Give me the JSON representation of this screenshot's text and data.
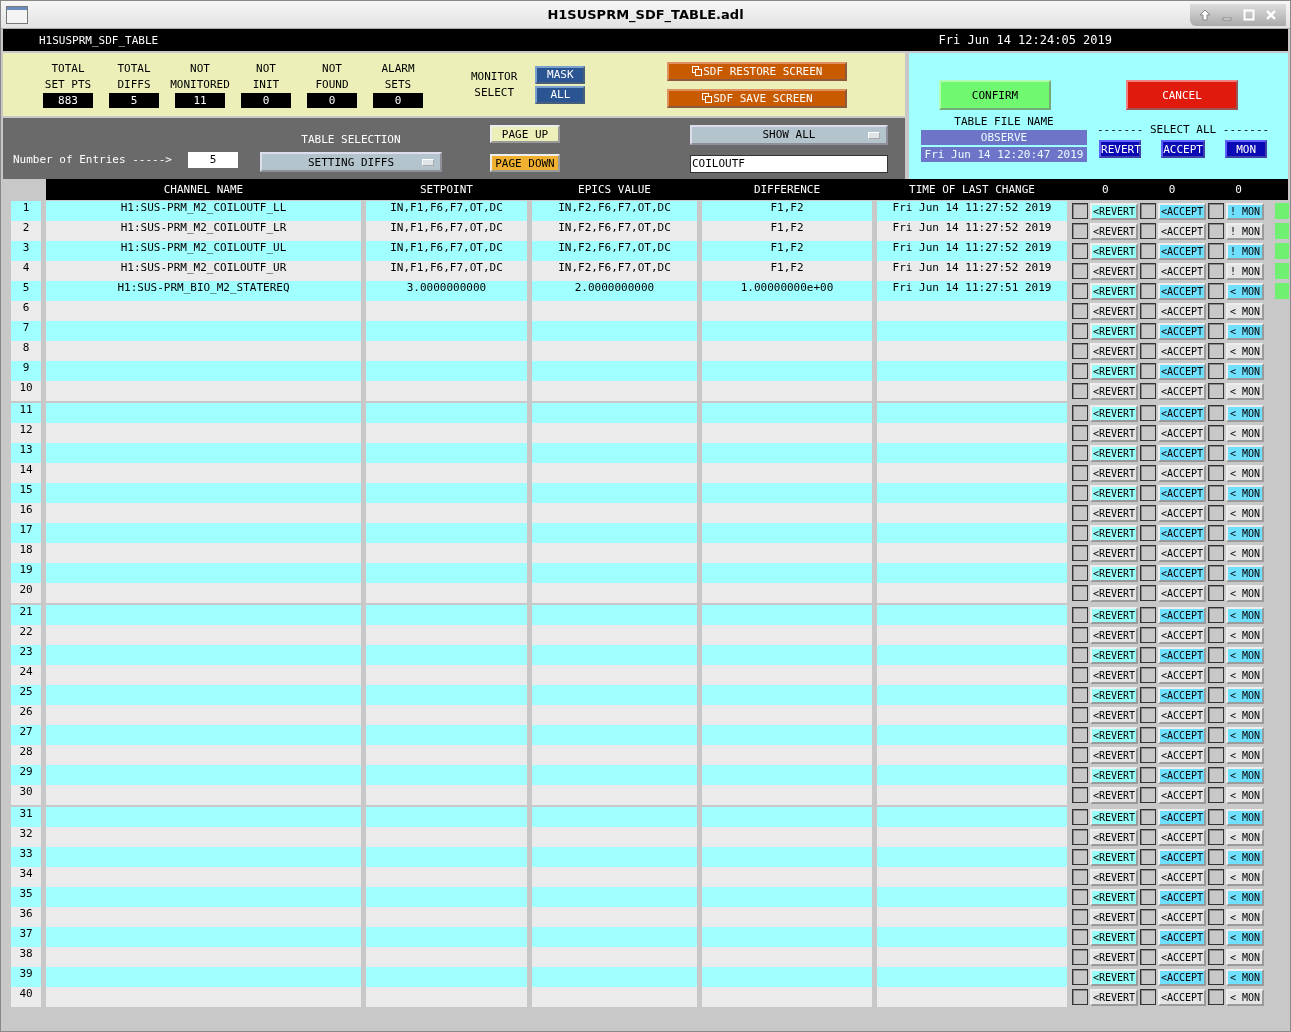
{
  "window": {
    "title": "H1SUSPRM_SDF_TABLE.adl"
  },
  "header_bar": {
    "screen_name": "H1SUSPRM_SDF_TABLE",
    "clock": "Fri Jun 14 12:24:05 2019"
  },
  "stats": [
    {
      "lines": [
        "TOTAL",
        "SET PTS"
      ],
      "value": "883"
    },
    {
      "lines": [
        "TOTAL",
        "DIFFS"
      ],
      "value": "5"
    },
    {
      "lines": [
        "NOT",
        "MONITORED"
      ],
      "value": "11"
    },
    {
      "lines": [
        "NOT",
        "INIT"
      ],
      "value": "0"
    },
    {
      "lines": [
        "NOT",
        "FOUND"
      ],
      "value": "0"
    },
    {
      "lines": [
        "ALARM",
        "SETS"
      ],
      "value": "0"
    }
  ],
  "monitor_select": {
    "lines": [
      "MONITOR",
      "SELECT"
    ],
    "buttons": [
      "MASK",
      "ALL"
    ]
  },
  "screen_buttons": [
    "SDF RESTORE SCREEN",
    "SDF SAVE SCREEN"
  ],
  "confirm": "CONFIRM",
  "cancel": "CANCEL",
  "table_file": {
    "label": "TABLE FILE NAME",
    "name": "OBSERVE",
    "date": "Fri Jun 14 12:20:47 2019"
  },
  "select_all": {
    "label": "------- SELECT ALL -------",
    "buttons": [
      "REVERT",
      "ACCEPT",
      "MON"
    ]
  },
  "entries": {
    "label": "Number of Entries ----->",
    "value": "5"
  },
  "table_selection": {
    "label": "TABLE SELECTION",
    "value": "SETTING DIFFS"
  },
  "page_buttons": [
    "PAGE UP",
    "PAGE DOWN"
  ],
  "filter": {
    "value": "SHOW ALL"
  },
  "search": {
    "value": "COILOUTF"
  },
  "columns": [
    "CHANNEL NAME",
    "SETPOINT",
    "EPICS VALUE",
    "DIFFERENCE",
    "TIME OF LAST CHANGE",
    "0",
    "0",
    "0"
  ],
  "rows": [
    {
      "number": "1",
      "channel": "H1:SUS-PRM_M2_COILOUTF_LL",
      "setpoint": "IN,F1,F6,F7,OT,DC",
      "epics_value": "IN,F2,F6,F7,OT,DC",
      "difference": "F1,F2",
      "time": "Fri Jun 14 11:27:52 2019",
      "revert_label": "<REVERT",
      "accept_label": "<ACCEPT",
      "mon_label": "! MON",
      "flagged": true,
      "revert_checked": false,
      "accept_checked": false,
      "mon_checked": false
    },
    {
      "number": "2",
      "channel": "H1:SUS-PRM_M2_COILOUTF_LR",
      "setpoint": "IN,F1,F6,F7,OT,DC",
      "epics_value": "IN,F2,F6,F7,OT,DC",
      "difference": "F1,F2",
      "time": "Fri Jun 14 11:27:52 2019",
      "revert_label": "<REVERT",
      "accept_label": "<ACCEPT",
      "mon_label": "! MON",
      "flagged": true,
      "revert_checked": false,
      "accept_checked": false,
      "mon_checked": false
    },
    {
      "number": "3",
      "channel": "H1:SUS-PRM_M2_COILOUTF_UL",
      "setpoint": "IN,F1,F6,F7,OT,DC",
      "epics_value": "IN,F2,F6,F7,OT,DC",
      "difference": "F1,F2",
      "time": "Fri Jun 14 11:27:52 2019",
      "revert_label": "<REVERT",
      "accept_label": "<ACCEPT",
      "mon_label": "! MON",
      "flagged": true,
      "revert_checked": false,
      "accept_checked": false,
      "mon_checked": false
    },
    {
      "number": "4",
      "channel": "H1:SUS-PRM_M2_COILOUTF_UR",
      "setpoint": "IN,F1,F6,F7,OT,DC",
      "epics_value": "IN,F2,F6,F7,OT,DC",
      "difference": "F1,F2",
      "time": "Fri Jun 14 11:27:52 2019",
      "revert_label": "<REVERT",
      "accept_label": "<ACCEPT",
      "mon_label": "! MON",
      "flagged": true,
      "revert_checked": false,
      "accept_checked": false,
      "mon_checked": false
    },
    {
      "number": "5",
      "channel": "H1:SUS-PRM_BIO_M2_STATEREQ",
      "setpoint": "3.0000000000",
      "epics_value": "2.0000000000",
      "difference": "1.00000000e+00",
      "time": "Fri Jun 14 11:27:51 2019",
      "revert_label": "<REVERT",
      "accept_label": "<ACCEPT",
      "mon_label": "< MON",
      "flagged": true,
      "revert_checked": false,
      "accept_checked": false,
      "mon_checked": false
    },
    {
      "number": "6",
      "revert_label": "<REVERT",
      "accept_label": "<ACCEPT",
      "mon_label": "< MON",
      "flagged": false,
      "revert_checked": false,
      "accept_checked": false,
      "mon_checked": false
    },
    {
      "number": "7",
      "revert_label": "<REVERT",
      "accept_label": "<ACCEPT",
      "mon_label": "< MON",
      "flagged": false,
      "revert_checked": false,
      "accept_checked": false,
      "mon_checked": false
    },
    {
      "number": "8",
      "revert_label": "<REVERT",
      "accept_label": "<ACCEPT",
      "mon_label": "< MON",
      "flagged": false,
      "revert_checked": false,
      "accept_checked": false,
      "mon_checked": false
    },
    {
      "number": "9",
      "revert_label": "<REVERT",
      "accept_label": "<ACCEPT",
      "mon_label": "< MON",
      "flagged": false,
      "revert_checked": false,
      "accept_checked": false,
      "mon_checked": false
    },
    {
      "number": "10",
      "revert_label": "<REVERT",
      "accept_label": "<ACCEPT",
      "mon_label": "< MON",
      "flagged": false,
      "revert_checked": false,
      "accept_checked": false,
      "mon_checked": false
    },
    {
      "number": "11",
      "revert_label": "<REVERT",
      "accept_label": "<ACCEPT",
      "mon_label": "< MON",
      "flagged": false,
      "revert_checked": false,
      "accept_checked": false,
      "mon_checked": false
    },
    {
      "number": "12",
      "revert_label": "<REVERT",
      "accept_label": "<ACCEPT",
      "mon_label": "< MON",
      "flagged": false,
      "revert_checked": false,
      "accept_checked": false,
      "mon_checked": false
    },
    {
      "number": "13",
      "revert_label": "<REVERT",
      "accept_label": "<ACCEPT",
      "mon_label": "< MON",
      "flagged": false,
      "revert_checked": false,
      "accept_checked": false,
      "mon_checked": false
    },
    {
      "number": "14",
      "revert_label": "<REVERT",
      "accept_label": "<ACCEPT",
      "mon_label": "< MON",
      "flagged": false,
      "revert_checked": false,
      "accept_checked": false,
      "mon_checked": false
    },
    {
      "number": "15",
      "revert_label": "<REVERT",
      "accept_label": "<ACCEPT",
      "mon_label": "< MON",
      "flagged": false,
      "revert_checked": false,
      "accept_checked": false,
      "mon_checked": false
    },
    {
      "number": "16",
      "revert_label": "<REVERT",
      "accept_label": "<ACCEPT",
      "mon_label": "< MON",
      "flagged": false,
      "revert_checked": false,
      "accept_checked": false,
      "mon_checked": false
    },
    {
      "number": "17",
      "revert_label": "<REVERT",
      "accept_label": "<ACCEPT",
      "mon_label": "< MON",
      "flagged": false,
      "revert_checked": false,
      "accept_checked": false,
      "mon_checked": false
    },
    {
      "number": "18",
      "revert_label": "<REVERT",
      "accept_label": "<ACCEPT",
      "mon_label": "< MON",
      "flagged": false,
      "revert_checked": false,
      "accept_checked": false,
      "mon_checked": false
    },
    {
      "number": "19",
      "revert_label": "<REVERT",
      "accept_label": "<ACCEPT",
      "mon_label": "< MON",
      "flagged": false,
      "revert_checked": false,
      "accept_checked": false,
      "mon_checked": false
    },
    {
      "number": "20",
      "revert_label": "<REVERT",
      "accept_label": "<ACCEPT",
      "mon_label": "< MON",
      "flagged": false,
      "revert_checked": false,
      "accept_checked": false,
      "mon_checked": false
    },
    {
      "number": "21",
      "revert_label": "<REVERT",
      "accept_label": "<ACCEPT",
      "mon_label": "< MON",
      "flagged": false,
      "revert_checked": false,
      "accept_checked": false,
      "mon_checked": false
    },
    {
      "number": "22",
      "revert_label": "<REVERT",
      "accept_label": "<ACCEPT",
      "mon_label": "< MON",
      "flagged": false,
      "revert_checked": false,
      "accept_checked": false,
      "mon_checked": false
    },
    {
      "number": "23",
      "revert_label": "<REVERT",
      "accept_label": "<ACCEPT",
      "mon_label": "< MON",
      "flagged": false,
      "revert_checked": false,
      "accept_checked": false,
      "mon_checked": false
    },
    {
      "number": "24",
      "revert_label": "<REVERT",
      "accept_label": "<ACCEPT",
      "mon_label": "< MON",
      "flagged": false,
      "revert_checked": false,
      "accept_checked": false,
      "mon_checked": false
    },
    {
      "number": "25",
      "revert_label": "<REVERT",
      "accept_label": "<ACCEPT",
      "mon_label": "< MON",
      "flagged": false,
      "revert_checked": false,
      "accept_checked": false,
      "mon_checked": false
    },
    {
      "number": "26",
      "revert_label": "<REVERT",
      "accept_label": "<ACCEPT",
      "mon_label": "< MON",
      "flagged": false,
      "revert_checked": false,
      "accept_checked": false,
      "mon_checked": false
    },
    {
      "number": "27",
      "revert_label": "<REVERT",
      "accept_label": "<ACCEPT",
      "mon_label": "< MON",
      "flagged": false,
      "revert_checked": false,
      "accept_checked": false,
      "mon_checked": false
    },
    {
      "number": "28",
      "revert_label": "<REVERT",
      "accept_label": "<ACCEPT",
      "mon_label": "< MON",
      "flagged": false,
      "revert_checked": false,
      "accept_checked": false,
      "mon_checked": false
    },
    {
      "number": "29",
      "revert_label": "<REVERT",
      "accept_label": "<ACCEPT",
      "mon_label": "< MON",
      "flagged": false,
      "revert_checked": false,
      "accept_checked": false,
      "mon_checked": false
    },
    {
      "number": "30",
      "revert_label": "<REVERT",
      "accept_label": "<ACCEPT",
      "mon_label": "< MON",
      "flagged": false,
      "revert_checked": false,
      "accept_checked": false,
      "mon_checked": false
    },
    {
      "number": "31",
      "revert_label": "<REVERT",
      "accept_label": "<ACCEPT",
      "mon_label": "< MON",
      "flagged": false,
      "revert_checked": false,
      "accept_checked": false,
      "mon_checked": false
    },
    {
      "number": "32",
      "revert_label": "<REVERT",
      "accept_label": "<ACCEPT",
      "mon_label": "< MON",
      "flagged": false,
      "revert_checked": false,
      "accept_checked": false,
      "mon_checked": false
    },
    {
      "number": "33",
      "revert_label": "<REVERT",
      "accept_label": "<ACCEPT",
      "mon_label": "< MON",
      "flagged": false,
      "revert_checked": false,
      "accept_checked": false,
      "mon_checked": false
    },
    {
      "number": "34",
      "revert_label": "<REVERT",
      "accept_label": "<ACCEPT",
      "mon_label": "< MON",
      "flagged": false,
      "revert_checked": false,
      "accept_checked": false,
      "mon_checked": false
    },
    {
      "number": "35",
      "revert_label": "<REVERT",
      "accept_label": "<ACCEPT",
      "mon_label": "< MON",
      "flagged": false,
      "revert_checked": false,
      "accept_checked": false,
      "mon_checked": false
    },
    {
      "number": "36",
      "revert_label": "<REVERT",
      "accept_label": "<ACCEPT",
      "mon_label": "< MON",
      "flagged": false,
      "revert_checked": false,
      "accept_checked": false,
      "mon_checked": false
    },
    {
      "number": "37",
      "revert_label": "<REVERT",
      "accept_label": "<ACCEPT",
      "mon_label": "< MON",
      "flagged": false,
      "revert_checked": false,
      "accept_checked": false,
      "mon_checked": false
    },
    {
      "number": "38",
      "revert_label": "<REVERT",
      "accept_label": "<ACCEPT",
      "mon_label": "< MON",
      "flagged": false,
      "revert_checked": false,
      "accept_checked": false,
      "mon_checked": false
    },
    {
      "number": "39",
      "revert_label": "<REVERT",
      "accept_label": "<ACCEPT",
      "mon_label": "< MON",
      "flagged": false,
      "revert_checked": false,
      "accept_checked": false,
      "mon_checked": false
    },
    {
      "number": "40",
      "revert_label": "<REVERT",
      "accept_label": "<ACCEPT",
      "mon_label": "< MON",
      "flagged": false,
      "revert_checked": false,
      "accept_checked": false,
      "mon_checked": false
    }
  ]
}
